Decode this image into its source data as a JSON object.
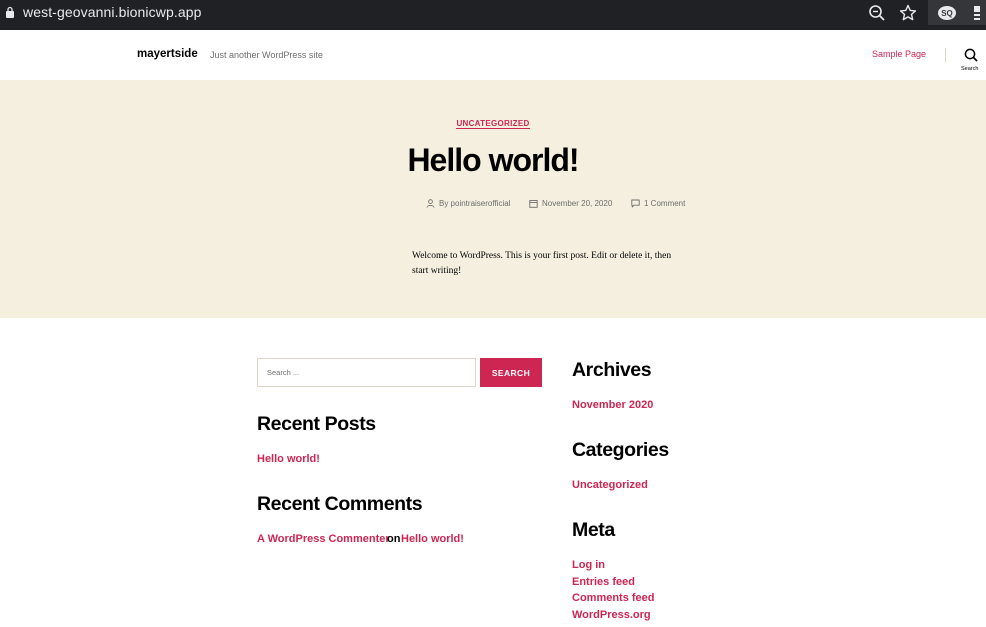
{
  "browser": {
    "url": "west-geovanni.bionicwp.app",
    "extension_label": "SQ"
  },
  "header": {
    "site_title": "mayertside",
    "site_description": "Just another WordPress site",
    "nav_item": "Sample Page",
    "search_label": "Search"
  },
  "post": {
    "category": "UNCATEGORIZED",
    "title": "Hello world!",
    "author": "By pointraiserofficial",
    "date": "November 20, 2020",
    "comments": "1 Comment",
    "body_line1": "Welcome to WordPress. This is your first post. Edit or delete it, then",
    "body_line2": "start writing!"
  },
  "widgets": {
    "search": {
      "placeholder": "Search ...",
      "button": "SEARCH"
    },
    "recent_posts": {
      "title": "Recent Posts",
      "items": [
        "Hello world!"
      ]
    },
    "recent_comments": {
      "title": "Recent Comments",
      "author": "A WordPress Commenter",
      "connector": "on",
      "post": "Hello world!"
    },
    "archives": {
      "title": "Archives",
      "items": [
        "November 2020"
      ]
    },
    "categories": {
      "title": "Categories",
      "items": [
        "Uncategorized"
      ]
    },
    "meta": {
      "title": "Meta",
      "items": [
        "Log in",
        "Entries feed",
        "Comments feed",
        "WordPress.org"
      ]
    }
  },
  "colors": {
    "accent": "#cd2653",
    "hero_background": "#f5efe0",
    "chrome_background": "#202124"
  }
}
